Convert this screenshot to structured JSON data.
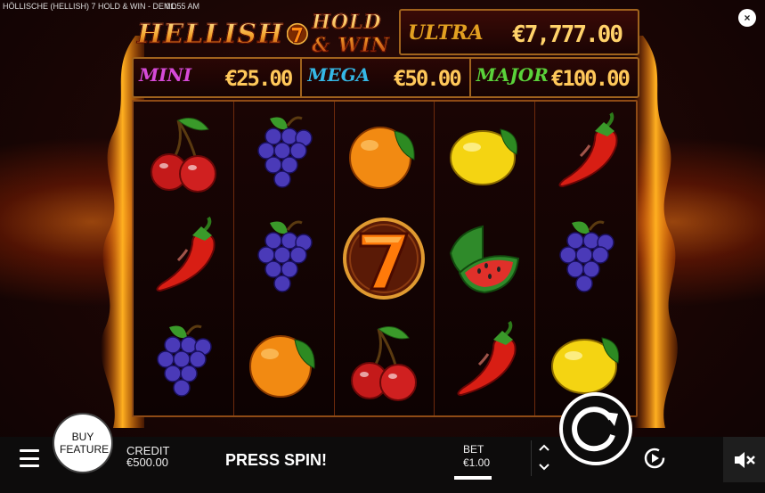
{
  "window": {
    "title": "HÖLLISCHE (HELLISH) 7 HOLD & WIN - DEMO",
    "clock": "01:55 AM"
  },
  "close": {
    "label": "×"
  },
  "logo": {
    "word1": "HELLISH",
    "seven": "7",
    "word2": "HOLD & WIN"
  },
  "jackpots": {
    "grand": {
      "label": "ULTRA",
      "value": "€7,777.00",
      "color": "#e2a021"
    },
    "mini": {
      "label": "MINI",
      "value": "€25.00",
      "color": "#d64ad8"
    },
    "mega": {
      "label": "MEGA",
      "value": "€50.00",
      "color": "#35b8e6"
    },
    "major": {
      "label": "MAJOR",
      "value": "€100.00",
      "color": "#5ad23a"
    }
  },
  "reels": [
    [
      "cherry",
      "chili",
      "grapes"
    ],
    [
      "grapes",
      "grapes",
      "orange"
    ],
    [
      "orange",
      "seven",
      "cherry"
    ],
    [
      "lemon",
      "watermelon",
      "chili"
    ],
    [
      "chili",
      "grapes",
      "lemon"
    ]
  ],
  "bottombar": {
    "buy_feature": "BUY FEATURE",
    "credit_label": "CREDIT",
    "credit_value": "€500.00",
    "status": "PRESS SPIN!",
    "bet_label": "BET",
    "bet_value": "€1.00",
    "bet_up_icon": "chevron-up-icon",
    "bet_down_icon": "chevron-down-icon"
  },
  "icons": {
    "menu": "hamburger-icon",
    "spin": "spin-icon",
    "autoplay": "autoplay-icon",
    "sound": "sound-muted-icon"
  }
}
